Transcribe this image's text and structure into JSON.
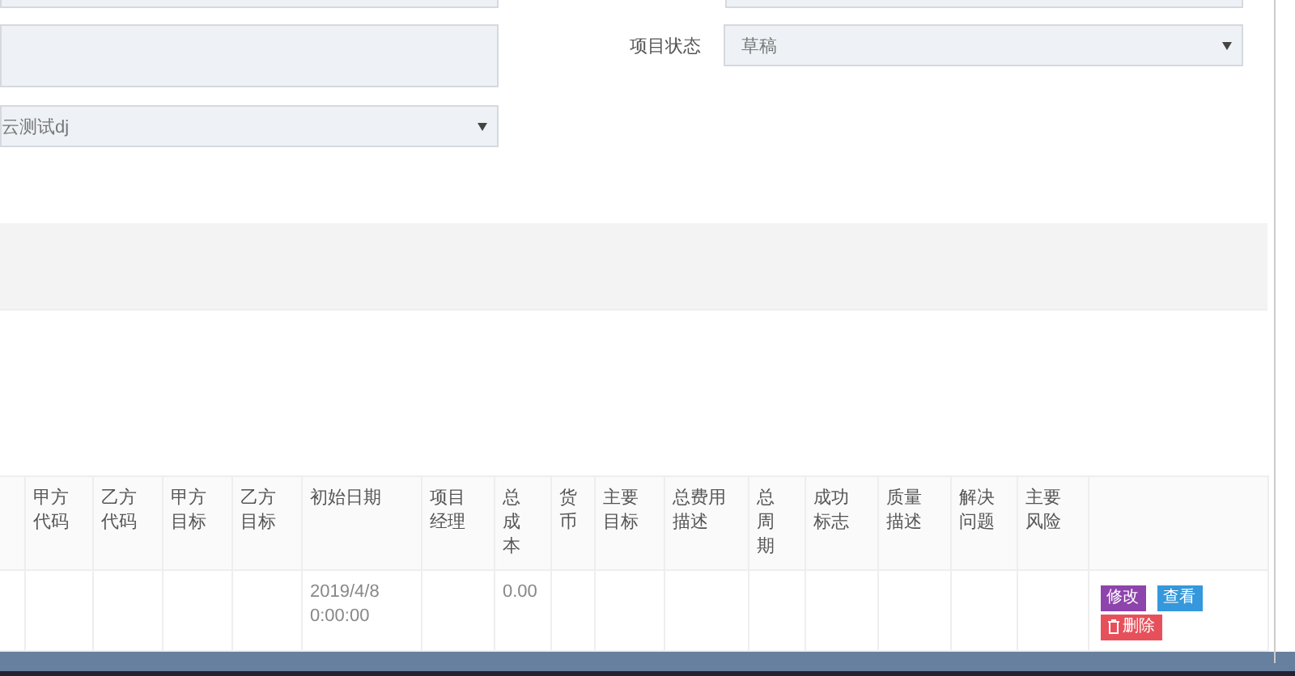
{
  "form": {
    "status_label": "项目状态",
    "status_value": "草稿",
    "client_value": "云测试dj"
  },
  "table": {
    "columns": [
      "",
      "甲方代码",
      "乙方代码",
      "甲方目标",
      "乙方目标",
      "初始日期",
      "项目经理",
      "总成本",
      "货币",
      "主要目标",
      "总费用描述",
      "总周期",
      "成功标志",
      "质量描述",
      "解决问题",
      "主要风险",
      ""
    ],
    "rows": [
      {
        "cells": [
          "",
          "",
          "",
          "",
          "",
          "2019/4/8 0:00:00",
          "",
          "0.00",
          "",
          "",
          "",
          "",
          "",
          "",
          "",
          "",
          ""
        ],
        "actions": [
          {
            "kind": "edit",
            "label": "修改"
          },
          {
            "kind": "view",
            "label": "查看"
          },
          {
            "kind": "delete",
            "label": "删除"
          }
        ]
      }
    ]
  }
}
